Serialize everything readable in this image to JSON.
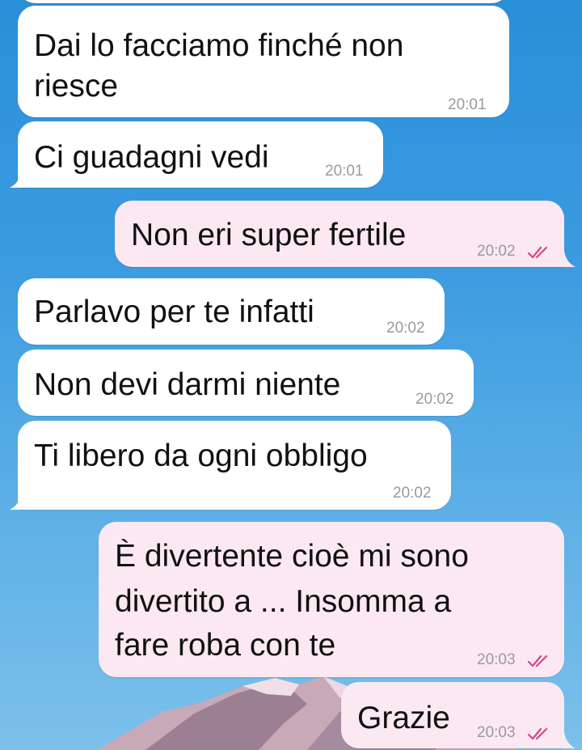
{
  "colors": {
    "incoming_bubble": "#ffffff",
    "outgoing_bubble": "#fbe8f1",
    "timestamp": "#9a9a9a",
    "read_ticks": "#d9448c"
  },
  "messages": [
    {
      "direction": "in",
      "lines": [
        "Dai lo facciamo finché non",
        "riesce"
      ],
      "time": "20:01"
    },
    {
      "direction": "in",
      "lines": [
        "Ci guadagni vedi"
      ],
      "time": "20:01"
    },
    {
      "direction": "out",
      "lines": [
        "Non eri super fertile"
      ],
      "time": "20:02",
      "status_icon": "double-check-icon"
    },
    {
      "direction": "in",
      "lines": [
        "Parlavo per te infatti"
      ],
      "time": "20:02"
    },
    {
      "direction": "in",
      "lines": [
        "Non devi darmi niente"
      ],
      "time": "20:02"
    },
    {
      "direction": "in",
      "lines": [
        "Ti libero da ogni obbligo"
      ],
      "time": "20:02"
    },
    {
      "direction": "out",
      "lines": [
        "È divertente cioè mi sono",
        "divertito a ... Insomma a",
        "fare roba con te"
      ],
      "time": "20:03",
      "status_icon": "double-check-icon"
    },
    {
      "direction": "out",
      "lines": [
        "Grazie"
      ],
      "time": "20:03",
      "status_icon": "double-check-icon"
    }
  ]
}
